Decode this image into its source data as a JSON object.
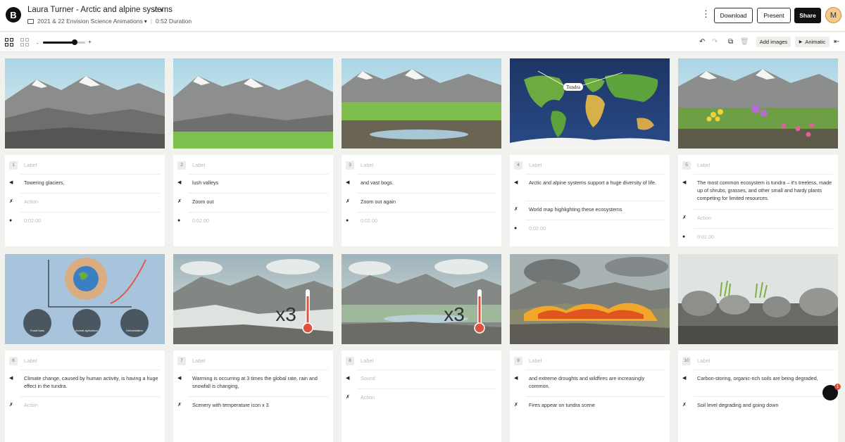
{
  "header": {
    "logo": "B",
    "title": "Laura Turner - Arctic and alpine systems",
    "version": "v3",
    "folder": "2021 & 22 Envision Science Animations",
    "duration": "0:52 Duration",
    "download": "Download",
    "present": "Present",
    "share": "Share",
    "avatar": "M"
  },
  "toolbar": {
    "zoom_minus": "-",
    "zoom_plus": "+",
    "zoom_level": 0.75,
    "add_images": "Add images",
    "animatic": "Animatic"
  },
  "frames": [
    {
      "num": "1",
      "label": "Label",
      "sound": "Towering glaciers,",
      "action": "Action",
      "time": "0:02.00",
      "action_placeholder": true
    },
    {
      "num": "2",
      "label": "Label",
      "sound": "lush valleys",
      "action": "Zoom out",
      "time": "0:02.00",
      "action_placeholder": false
    },
    {
      "num": "3",
      "label": "Label",
      "sound": "and vast bogs.",
      "action": "Zoom out again",
      "time": "0:02.00",
      "action_placeholder": false
    },
    {
      "num": "4",
      "label": "Label",
      "sound": "Arctic and alpine systems support a huge diversity of life.",
      "action": "World map highlighting these ecosystems",
      "time": "0:02.00",
      "action_placeholder": false,
      "map_label": "Tundra"
    },
    {
      "num": "5",
      "label": "Label",
      "sound": "The most common ecosystem is tundra – it's treeless, made up of shrubs, grasses, and other small and hardy plants competing for limited resources.",
      "action": "Action",
      "time": "0:02.00",
      "action_placeholder": true
    },
    {
      "num": "6",
      "label": "Label",
      "sound": "Climate change, caused by human activity, is having a huge effect in the tundra.",
      "action": "Action",
      "action_placeholder": true,
      "circle_labels": [
        "Fossil fuels",
        "Animal agriculture",
        "Deforestation"
      ]
    },
    {
      "num": "7",
      "label": "Label",
      "sound": "Warming is occurring at 3 times the global rate, rain and snowfall is changing,",
      "action": "Scenery with temperature icon x 3",
      "action_placeholder": false,
      "overlay": "x3"
    },
    {
      "num": "8",
      "label": "Label",
      "sound": "Sound",
      "action": "Action",
      "action_placeholder": true,
      "sound_placeholder": true,
      "overlay": "x3"
    },
    {
      "num": "9",
      "label": "Label",
      "sound": "and extreme droughts and wildfires are increasingly common.",
      "action": "Fires appear on tundra scene",
      "action_placeholder": false
    },
    {
      "num": "10",
      "label": "Label",
      "sound": "Carbon-storing, organic-rich soils are being degraded,",
      "action": "Soil level degrading and going down",
      "action_placeholder": false
    }
  ],
  "chat_badge": "1"
}
